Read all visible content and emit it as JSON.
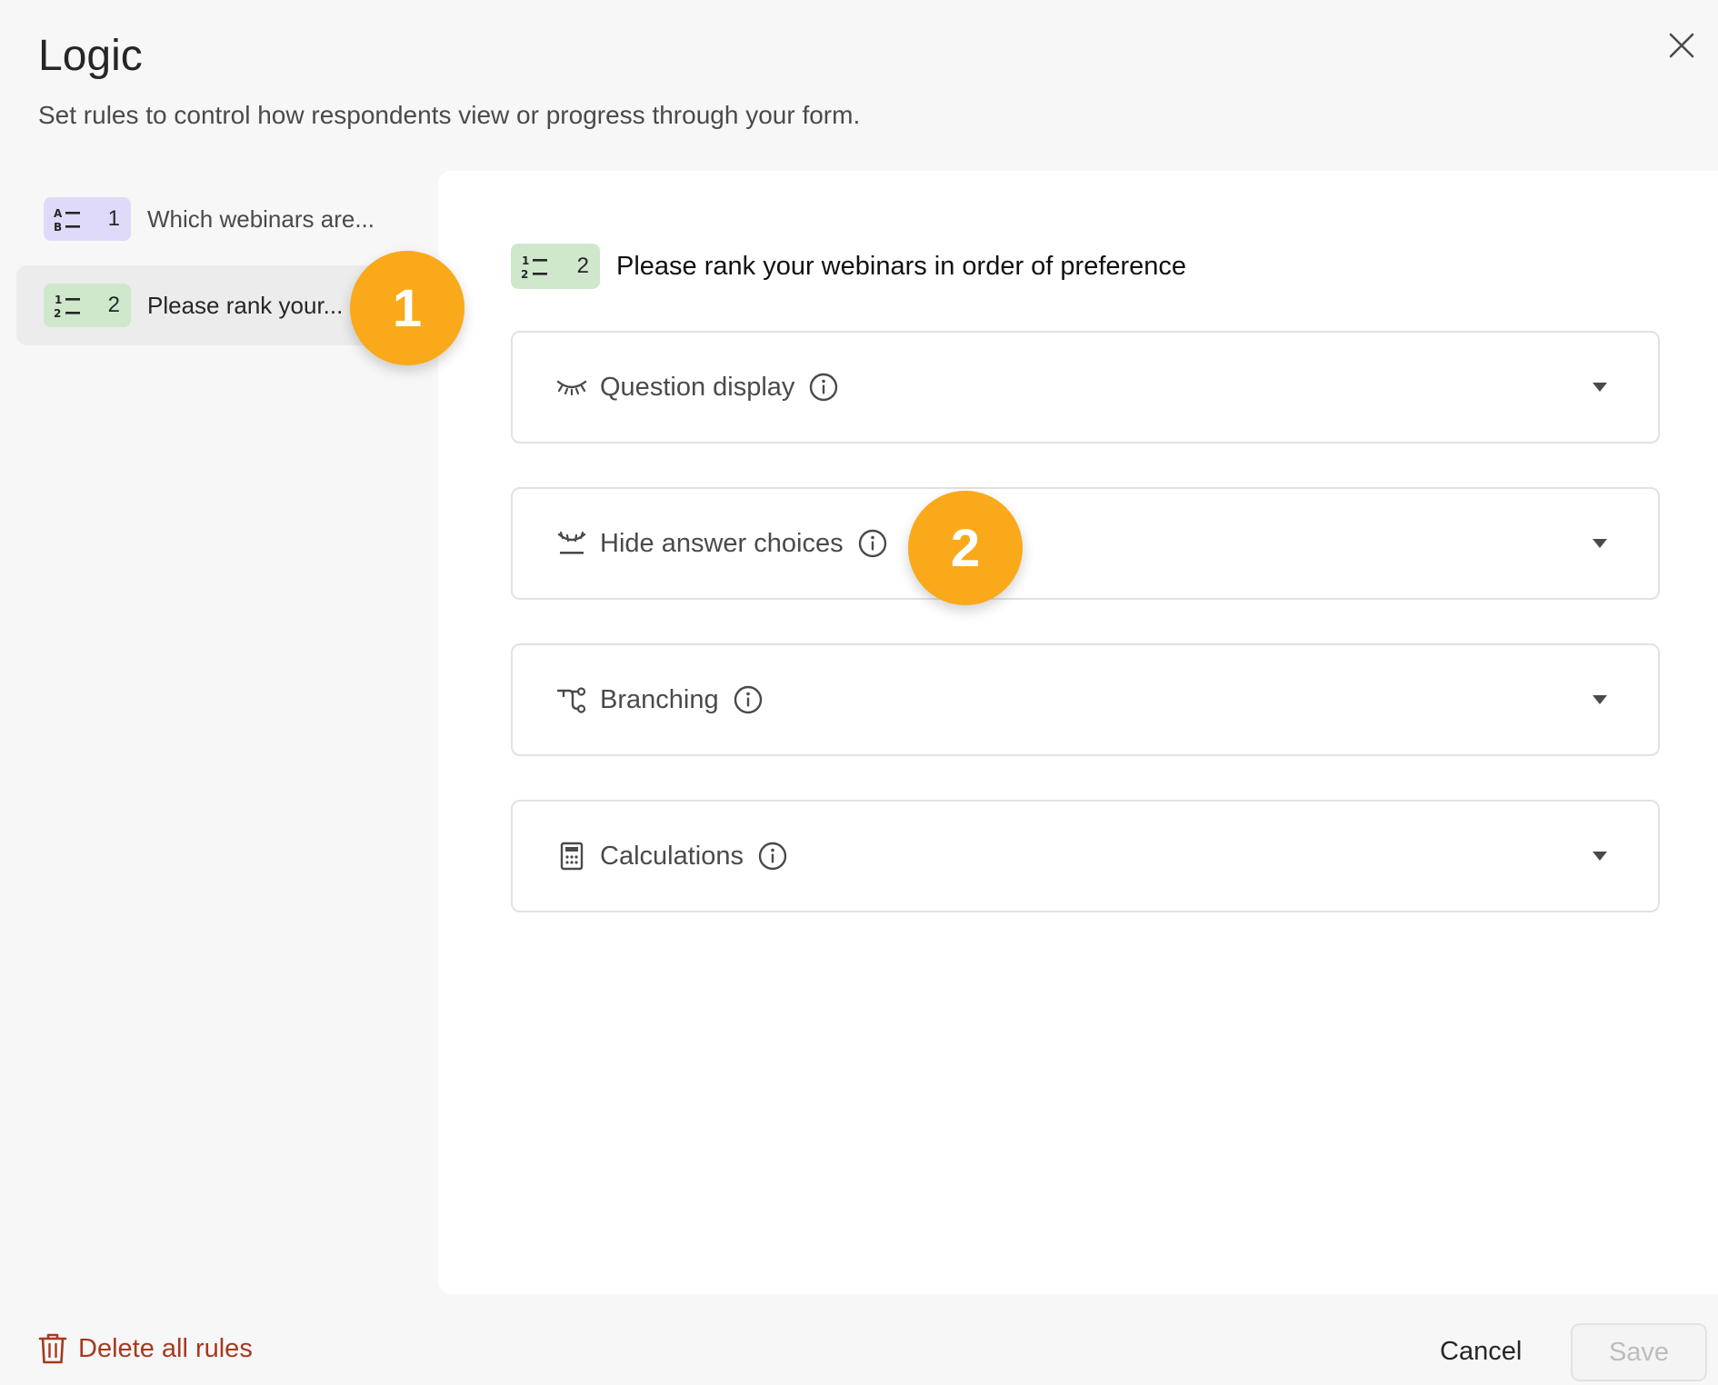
{
  "header": {
    "title": "Logic",
    "subtitle": "Set rules to control how respondents view or progress through your form."
  },
  "sidebar": {
    "items": [
      {
        "icon": "multiple-choice-icon",
        "number": "1",
        "label": "Which webinars are...",
        "badge_color": "#e0dafa",
        "active": false
      },
      {
        "icon": "ranking-icon",
        "number": "2",
        "label": "Please rank your...",
        "badge_color": "#cfe8cc",
        "active": true
      }
    ]
  },
  "panel": {
    "question_number": "2",
    "question_title": "Please rank your webinars in order of preference",
    "sections": [
      {
        "icon": "eye-closed-icon",
        "label": "Question display"
      },
      {
        "icon": "hide-choices-icon",
        "label": "Hide answer choices"
      },
      {
        "icon": "branching-icon",
        "label": "Branching"
      },
      {
        "icon": "calculator-icon",
        "label": "Calculations"
      }
    ]
  },
  "callouts": [
    "1",
    "2"
  ],
  "footer": {
    "delete_label": "Delete all rules",
    "cancel_label": "Cancel",
    "save_label": "Save"
  },
  "colors": {
    "accent_orange": "#f9a91a",
    "danger": "#a7391f",
    "purple_badge": "#e0dafa",
    "green_badge": "#cfe8cc"
  }
}
